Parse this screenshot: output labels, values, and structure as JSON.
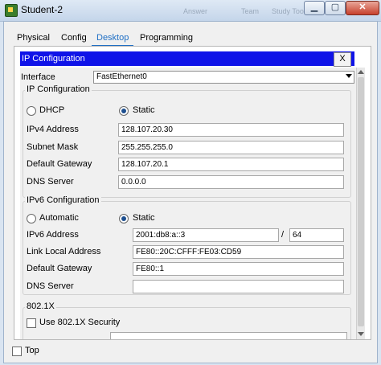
{
  "window": {
    "title": "Student-2",
    "background_menu_hints": [
      "Answer",
      "Team",
      "Study Tools"
    ]
  },
  "tabs": [
    {
      "label": "Physical",
      "active": false
    },
    {
      "label": "Config",
      "active": false
    },
    {
      "label": "Desktop",
      "active": true
    },
    {
      "label": "Programming",
      "active": false
    }
  ],
  "ip_config": {
    "header": "IP Configuration",
    "close_label": "X",
    "interface_label": "Interface",
    "interface_value": "FastEthernet0",
    "ipv4": {
      "section_label": "IP Configuration",
      "dhcp_label": "DHCP",
      "static_label": "Static",
      "mode": "static",
      "ipv4_address_label": "IPv4 Address",
      "ipv4_address": "128.107.20.30",
      "subnet_mask_label": "Subnet Mask",
      "subnet_mask": "255.255.255.0",
      "default_gateway_label": "Default Gateway",
      "default_gateway": "128.107.20.1",
      "dns_server_label": "DNS Server",
      "dns_server": "0.0.0.0"
    },
    "ipv6": {
      "section_label": "IPv6 Configuration",
      "automatic_label": "Automatic",
      "static_label": "Static",
      "mode": "static",
      "ipv6_address_label": "IPv6 Address",
      "ipv6_address": "2001:db8:a::3",
      "prefix_separator": "/",
      "prefix_length": "64",
      "link_local_label": "Link Local Address",
      "link_local": "FE80::20C:CFFF:FE03:CD59",
      "default_gateway_label": "Default Gateway",
      "default_gateway": "FE80::1",
      "dns_server_label": "DNS Server",
      "dns_server": ""
    },
    "dot1x": {
      "section_label": "802.1X",
      "use_label": "Use 802.1X Security",
      "checked": false
    }
  },
  "footer": {
    "top_label": "Top",
    "top_checked": false
  },
  "colors": {
    "accent": "#1f6fc5",
    "ip_bar": "#0f13e8"
  }
}
